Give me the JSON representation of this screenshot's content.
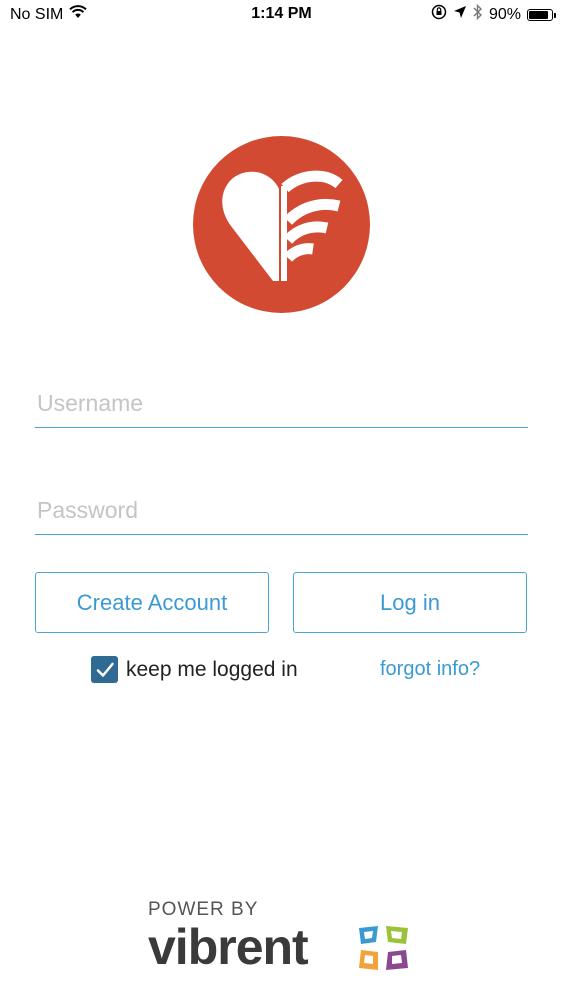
{
  "status_bar": {
    "carrier": "No SIM",
    "time": "1:14 PM",
    "battery_percent": "90%",
    "battery_level": 0.9
  },
  "login": {
    "username_placeholder": "Username",
    "password_placeholder": "Password",
    "create_account_label": "Create Account",
    "login_label": "Log in",
    "keep_logged_in_label": "keep me logged in",
    "keep_logged_in_checked": true,
    "forgot_label": "forgot info?"
  },
  "footer": {
    "power_by": "POWER BY",
    "brand": "vibrent"
  },
  "colors": {
    "accent": "#3b9ad4",
    "logo_red": "#d24a32",
    "checkbox": "#2f6a95"
  },
  "icons": {
    "wifi": "wifi-icon",
    "lock_rotation": "orientation-lock-icon",
    "location": "location-arrow-icon",
    "bluetooth": "bluetooth-icon",
    "battery": "battery-icon",
    "logo": "heart-signal-logo",
    "check": "checkmark-icon",
    "brand_mark": "vibrent-mark-icon"
  }
}
